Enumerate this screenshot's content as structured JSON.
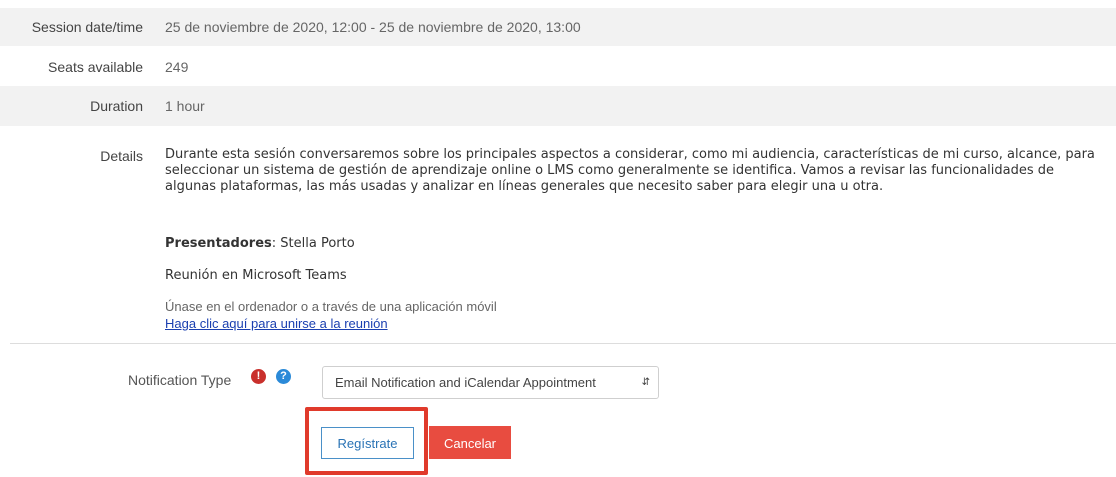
{
  "session": {
    "date_label": "Session date/time",
    "date_value": "25 de noviembre de 2020, 12:00 - 25 de noviembre de 2020, 13:00",
    "seats_label": "Seats available",
    "seats_value": "249",
    "duration_label": "Duration",
    "duration_value": "1 hour",
    "details_label": "Details",
    "details_text": "Durante esta sesión conversaremos sobre los principales aspectos a considerar, como mi audiencia, características de mi curso,  alcance, para seleccionar  un sistema de gestión de aprendizaje online o LMS como generalmente se identifica.   Vamos a revisar las funcionalidades de algunas plataformas, las más usadas y analizar en líneas generales que necesito saber para elegir una u otra.",
    "presenters_label": "Presentadores",
    "presenters_value": ": Stella Porto",
    "meeting_platform": "Reunión en Microsoft Teams",
    "join_note": "Únase en el ordenador o a través de una aplicación móvil",
    "join_link": "Haga clic aquí para unirse a la reunión"
  },
  "form": {
    "notification_label": "Notification Type",
    "notification_selected": "Email Notification and iCalendar Appointment",
    "register_label": "Regístrate",
    "cancel_label": "Cancelar"
  },
  "icons": {
    "warning": "exclamation-circle-icon",
    "help": "question-circle-icon",
    "warning_color": "#c9302c",
    "help_color": "#2b8ad8",
    "cancel_color": "#e84c40",
    "highlight_color": "#e03a2b"
  }
}
